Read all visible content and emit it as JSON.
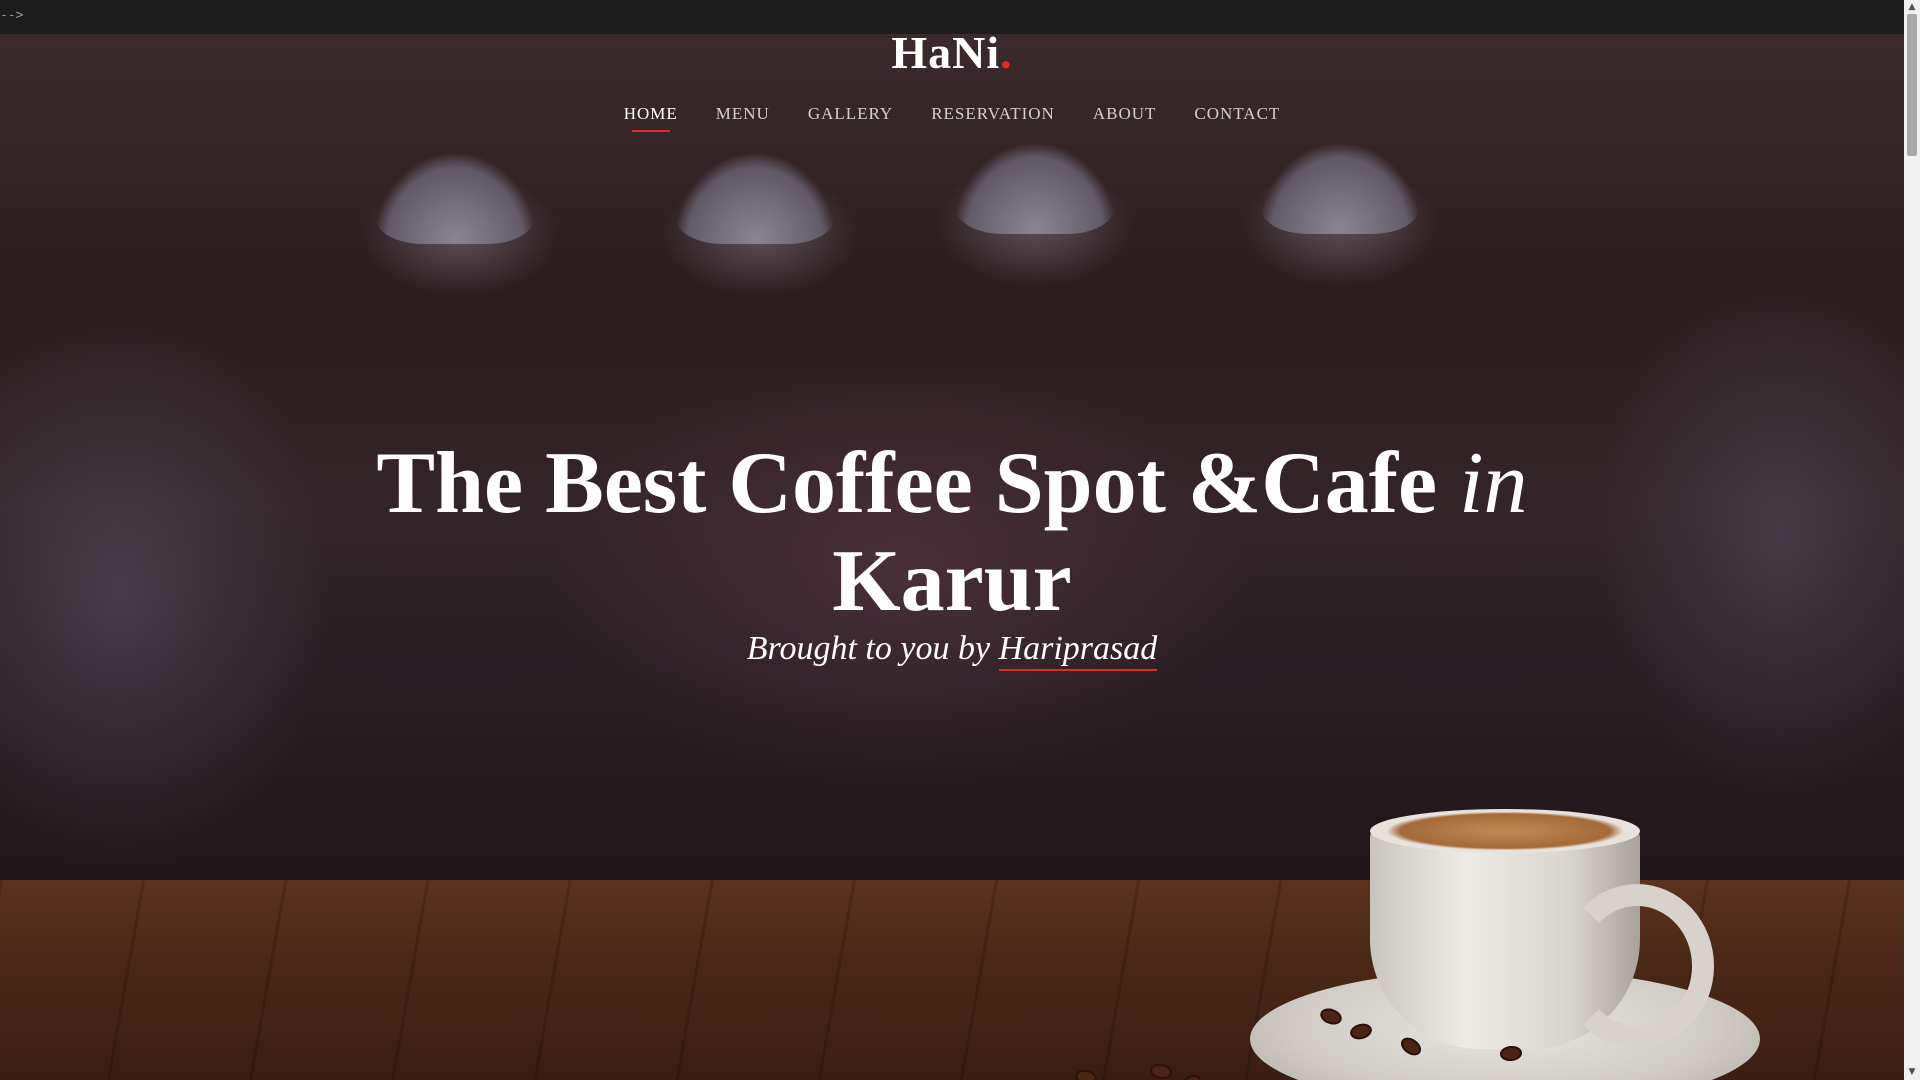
{
  "stray_text": "-->",
  "brand": {
    "name": "HaNi",
    "dot": ".",
    "dot_color": "#e02a2a"
  },
  "nav": {
    "items": [
      {
        "label": "HOME",
        "active": true
      },
      {
        "label": "MENU"
      },
      {
        "label": "GALLERY"
      },
      {
        "label": "RESERVATION"
      },
      {
        "label": "ABOUT"
      },
      {
        "label": "CONTACT"
      }
    ]
  },
  "hero": {
    "headline_main": "The Best Coffee Spot &Cafe",
    "headline_italic": "in",
    "headline_end": "Karur",
    "sub_prefix": "Brought to you by",
    "sub_name": "Hariprasad"
  },
  "colors": {
    "accent": "#e02a2a",
    "text": "#ffffff"
  },
  "icons": [
    "scroll-up-arrow-icon",
    "scroll-down-arrow-icon"
  ]
}
